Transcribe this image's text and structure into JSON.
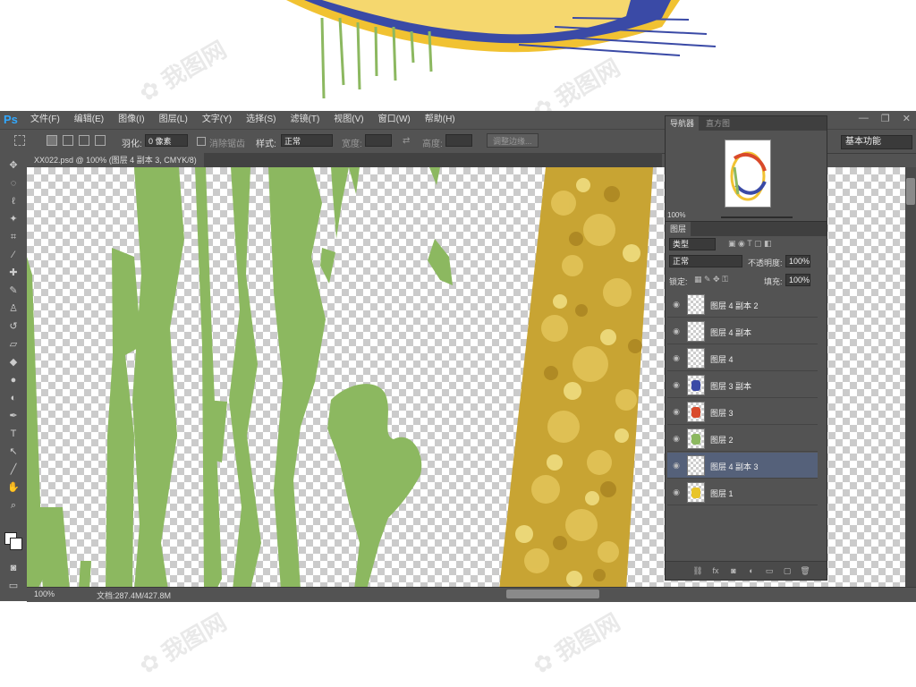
{
  "menu": {
    "logo": "Ps",
    "items": [
      "文件(F)",
      "编辑(E)",
      "图像(I)",
      "图层(L)",
      "文字(Y)",
      "选择(S)",
      "滤镜(T)",
      "视图(V)",
      "窗口(W)",
      "帮助(H)"
    ]
  },
  "window_controls": {
    "minimize": "—",
    "restore": "❐",
    "close": "✕"
  },
  "options": {
    "feather_label": "羽化:",
    "feather_value": "0 像素",
    "antialias_label": "消除锯齿",
    "style_label": "样式:",
    "style_value": "正常",
    "width_label": "宽度:",
    "height_label": "高度:",
    "refine_edge": "调整边缘..."
  },
  "workspace": "基本功能",
  "document_tab": "XX022.psd @ 100% (图层 4 副本 3, CMYK/8)",
  "status": {
    "zoom": "100%",
    "doc_size": "文档:287.4M/427.8M"
  },
  "navigator": {
    "tab_active": "导航器",
    "tab_inactive": "直方图",
    "zoom": "100%"
  },
  "layers_panel": {
    "title": "图层",
    "filter_kind": "类型",
    "blend_mode": "正常",
    "opacity_label": "不透明度:",
    "opacity_value": "100%",
    "lock_label": "锁定:",
    "fill_label": "填充:",
    "fill_value": "100%",
    "layers": [
      {
        "name": "图层 4 副本 2",
        "selected": false,
        "thumb": "blank"
      },
      {
        "name": "图层 4 副本",
        "selected": false,
        "thumb": "blank"
      },
      {
        "name": "图层 4",
        "selected": false,
        "thumb": "blank"
      },
      {
        "name": "图层 3 副本",
        "selected": false,
        "thumb": "blue"
      },
      {
        "name": "图层 3",
        "selected": false,
        "thumb": "red"
      },
      {
        "name": "图层 2",
        "selected": false,
        "thumb": "green"
      },
      {
        "name": "图层 4 副本 3",
        "selected": true,
        "thumb": "blank"
      },
      {
        "name": "图层 1",
        "selected": false,
        "thumb": "yellow"
      }
    ]
  },
  "colors": {
    "ui_bg": "#535353",
    "accent": "#31a8ff",
    "green_art": "#8cb860",
    "gold_art": "#d8b13c",
    "selected_row": "#55617a"
  }
}
